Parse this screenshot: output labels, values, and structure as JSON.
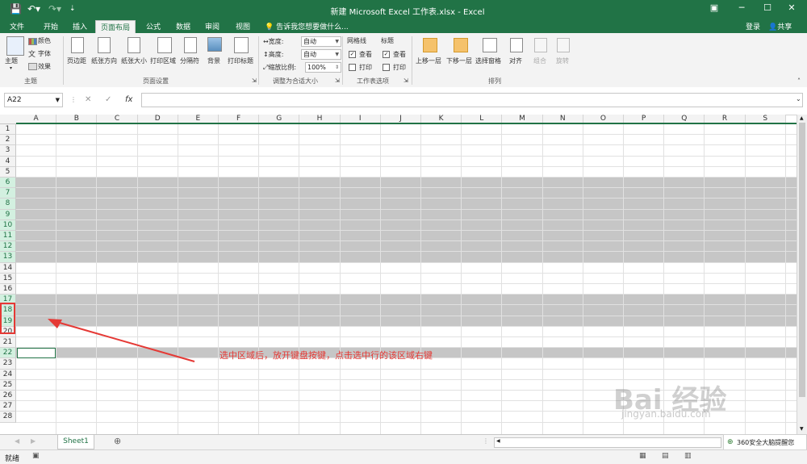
{
  "window": {
    "title": "新建 Microsoft Excel 工作表.xlsx - Excel"
  },
  "tabs": [
    {
      "label": "文件",
      "active": false
    },
    {
      "label": "开始",
      "active": false
    },
    {
      "label": "插入",
      "active": false
    },
    {
      "label": "页面布局",
      "active": true
    },
    {
      "label": "公式",
      "active": false
    },
    {
      "label": "数据",
      "active": false
    },
    {
      "label": "审阅",
      "active": false
    },
    {
      "label": "视图",
      "active": false
    }
  ],
  "tell_me": "告诉我您想要做什么...",
  "account": {
    "login": "登录",
    "share": "共享"
  },
  "ribbon": {
    "theme_group": {
      "name": "主题",
      "theme_btn": "主题",
      "colors": "颜色",
      "fonts": "字体",
      "effects": "效果"
    },
    "page_setup_group": {
      "name": "页面设置",
      "buttons": [
        "页边距",
        "纸张方向",
        "纸张大小",
        "打印区域",
        "分隔符",
        "背景",
        "打印标题"
      ]
    },
    "scale_group": {
      "name": "调整为合适大小",
      "width_label": "宽度:",
      "width_value": "自动",
      "height_label": "高度:",
      "height_value": "自动",
      "scale_label": "缩放比例:",
      "scale_value": "100%"
    },
    "sheet_options_group": {
      "name": "工作表选项",
      "gridlines": "网格线",
      "headings": "标题",
      "view": "查看",
      "print": "打印"
    },
    "arrange_group": {
      "name": "排列",
      "buttons": [
        "上移一层",
        "下移一层",
        "选择窗格",
        "对齐",
        "组合",
        "旋转"
      ]
    }
  },
  "formula_bar": {
    "name_box": "A22",
    "cancel": "✕",
    "enter": "✓",
    "fx": "fx",
    "formula": ""
  },
  "columns": [
    "A",
    "B",
    "C",
    "D",
    "E",
    "F",
    "G",
    "H",
    "I",
    "J",
    "K",
    "L",
    "M",
    "N",
    "O",
    "P",
    "Q",
    "R",
    "S"
  ],
  "rows": [
    "1",
    "2",
    "3",
    "4",
    "5",
    "6",
    "7",
    "8",
    "9",
    "10",
    "11",
    "12",
    "13",
    "14",
    "15",
    "16",
    "17",
    "18",
    "19",
    "20",
    "21",
    "22",
    "23",
    "24",
    "25",
    "26",
    "27",
    "28"
  ],
  "selected_rows": [
    "6",
    "7",
    "8",
    "9",
    "10",
    "11",
    "12",
    "13",
    "17",
    "18",
    "19",
    "22"
  ],
  "active_cell": "A22",
  "annotation": "选中区域后，放开键盘按键，点击选中行的该区域右键",
  "sheet_tabs": [
    "Sheet1"
  ],
  "status": {
    "ready": "就绪"
  },
  "notification": "360安全大脑提醒您",
  "watermark": {
    "brand": "Bai 经验",
    "url": "jingyan.baidu.com"
  },
  "colors": {
    "accent": "#217346",
    "selection": "#c6c6c6",
    "annotation": "#e53935"
  }
}
